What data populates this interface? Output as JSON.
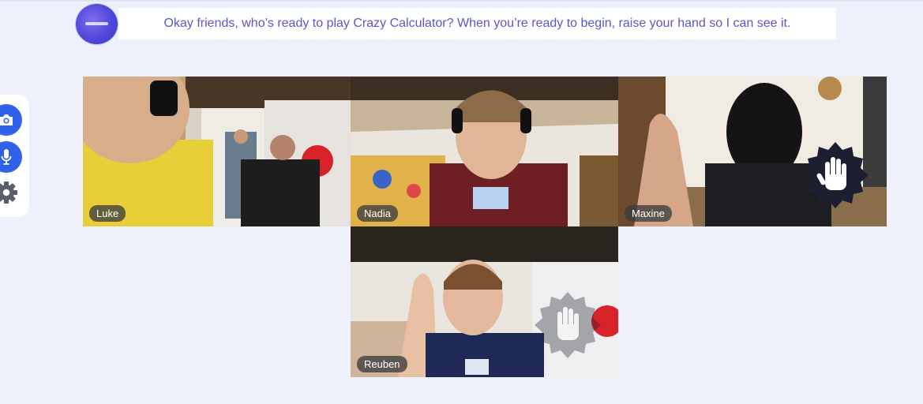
{
  "host": {
    "message": "Okay friends, who’s ready to play Crazy Calculator? When you’re ready to begin, raise your hand so I can see it."
  },
  "toolbar": {
    "camera_icon": "camera-icon",
    "mic_icon": "microphone-icon",
    "settings_icon": "gear-icon",
    "accent_color": "#2f62e8"
  },
  "participants": [
    {
      "name": "Luke",
      "hand_raised": false
    },
    {
      "name": "Nadia",
      "hand_raised": false
    },
    {
      "name": "Maxine",
      "hand_raised": true
    },
    {
      "name": "Reuben",
      "hand_raised": true
    }
  ]
}
